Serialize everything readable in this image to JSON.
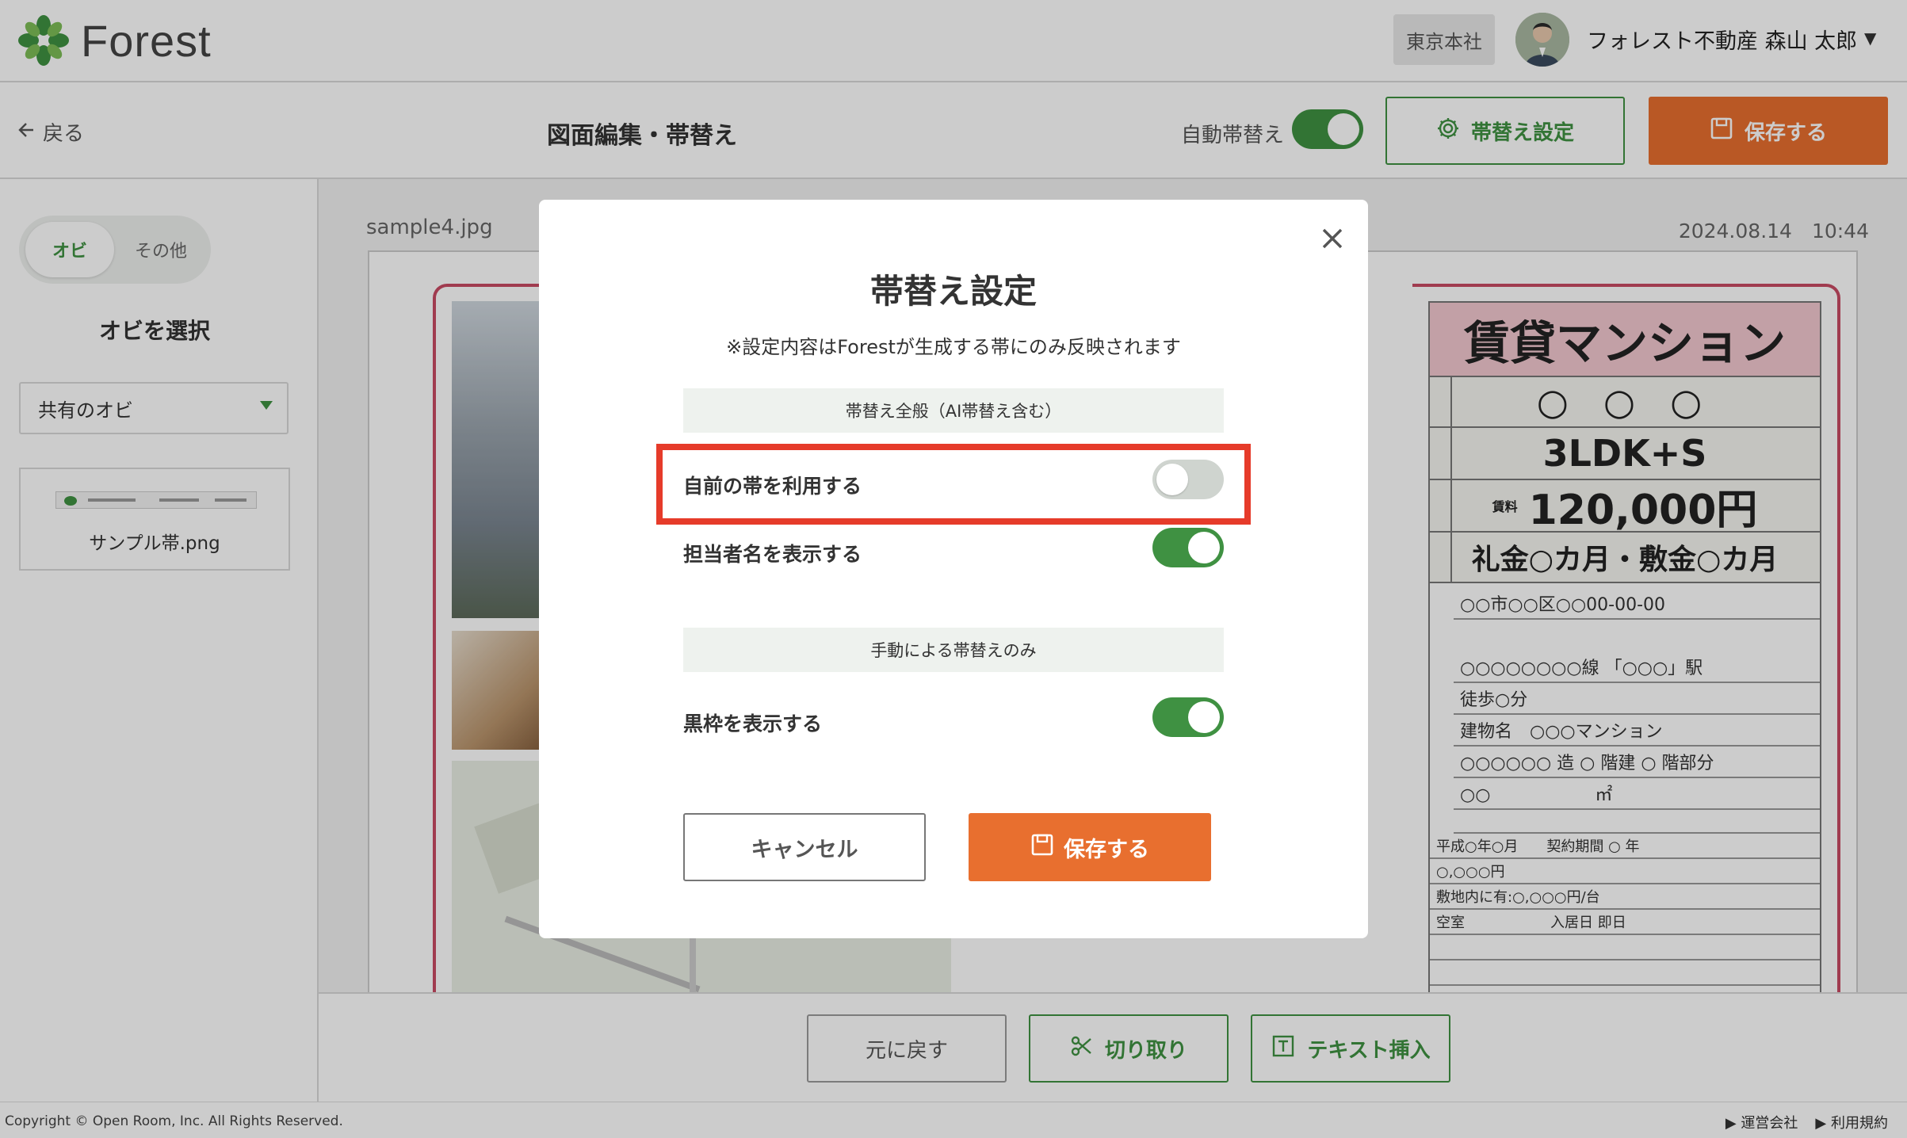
{
  "brand": {
    "name": "Forest",
    "accent": "#3f9142",
    "action": "#e86f2f"
  },
  "header": {
    "branch": "東京本社",
    "user_name": "フォレスト不動産 森山 太郎",
    "caret": "▼"
  },
  "subheader": {
    "back_label": "戻る",
    "title": "図面編集・帯替え",
    "auto_label": "自動帯替え",
    "auto_enabled": true,
    "settings_button": "帯替え設定",
    "save_button": "保存する"
  },
  "sidebar": {
    "tabs": [
      {
        "label": "オビ",
        "active": true
      },
      {
        "label": "その他",
        "active": false
      }
    ],
    "select_title": "オビを選択",
    "select_value": "共有のオビ",
    "obi_items": [
      {
        "name": "サンプル帯.png"
      }
    ]
  },
  "canvas": {
    "file_name": "sample4.jpg",
    "date": "2024.08.14　10:44",
    "spec": {
      "title": "賃貸マンション",
      "name": "○ ○ ○",
      "layout": "3LDK+S",
      "rent_label": "賃料",
      "rent": "120,000円",
      "deposit": "礼金○カ月・敷金○カ月",
      "lines": [
        "○○市○○区○○00-00-00",
        "○○○○○○○○線 「○○○」駅",
        "徒歩○分",
        "建物名　○○○マンション",
        "○○○○○○ 造 ○ 階建 ○ 階部分",
        "○○　　　　　　㎡",
        "",
        "平成○年○月　　契約期間 ○ 年",
        "○,○○○円",
        "敷地内に有:○,○○○円/台",
        "空室　　　　　　入居日 即日",
        "",
        ""
      ]
    }
  },
  "toolbar": {
    "undo": "元に戻す",
    "cut": "切り取り",
    "insert_text": "テキスト挿入"
  },
  "footer": {
    "copyright": "Copyright © Open Room, Inc. All Rights Reserved.",
    "links": [
      "▶ 運営会社",
      "▶ 利用規約"
    ]
  },
  "modal": {
    "title": "帯替え設定",
    "note": "※設定内容はForestが生成する帯にのみ反映されます",
    "section_general": "帯替え全般（AI帯替え含む）",
    "section_manual": "手動による帯替えのみ",
    "options": [
      {
        "label": "自前の帯を利用する",
        "enabled": false
      },
      {
        "label": "担当者名を表示する",
        "enabled": true
      },
      {
        "label": "黒枠を表示する",
        "enabled": true
      }
    ],
    "cancel": "キャンセル",
    "save": "保存する",
    "close_icon": "close-icon"
  }
}
